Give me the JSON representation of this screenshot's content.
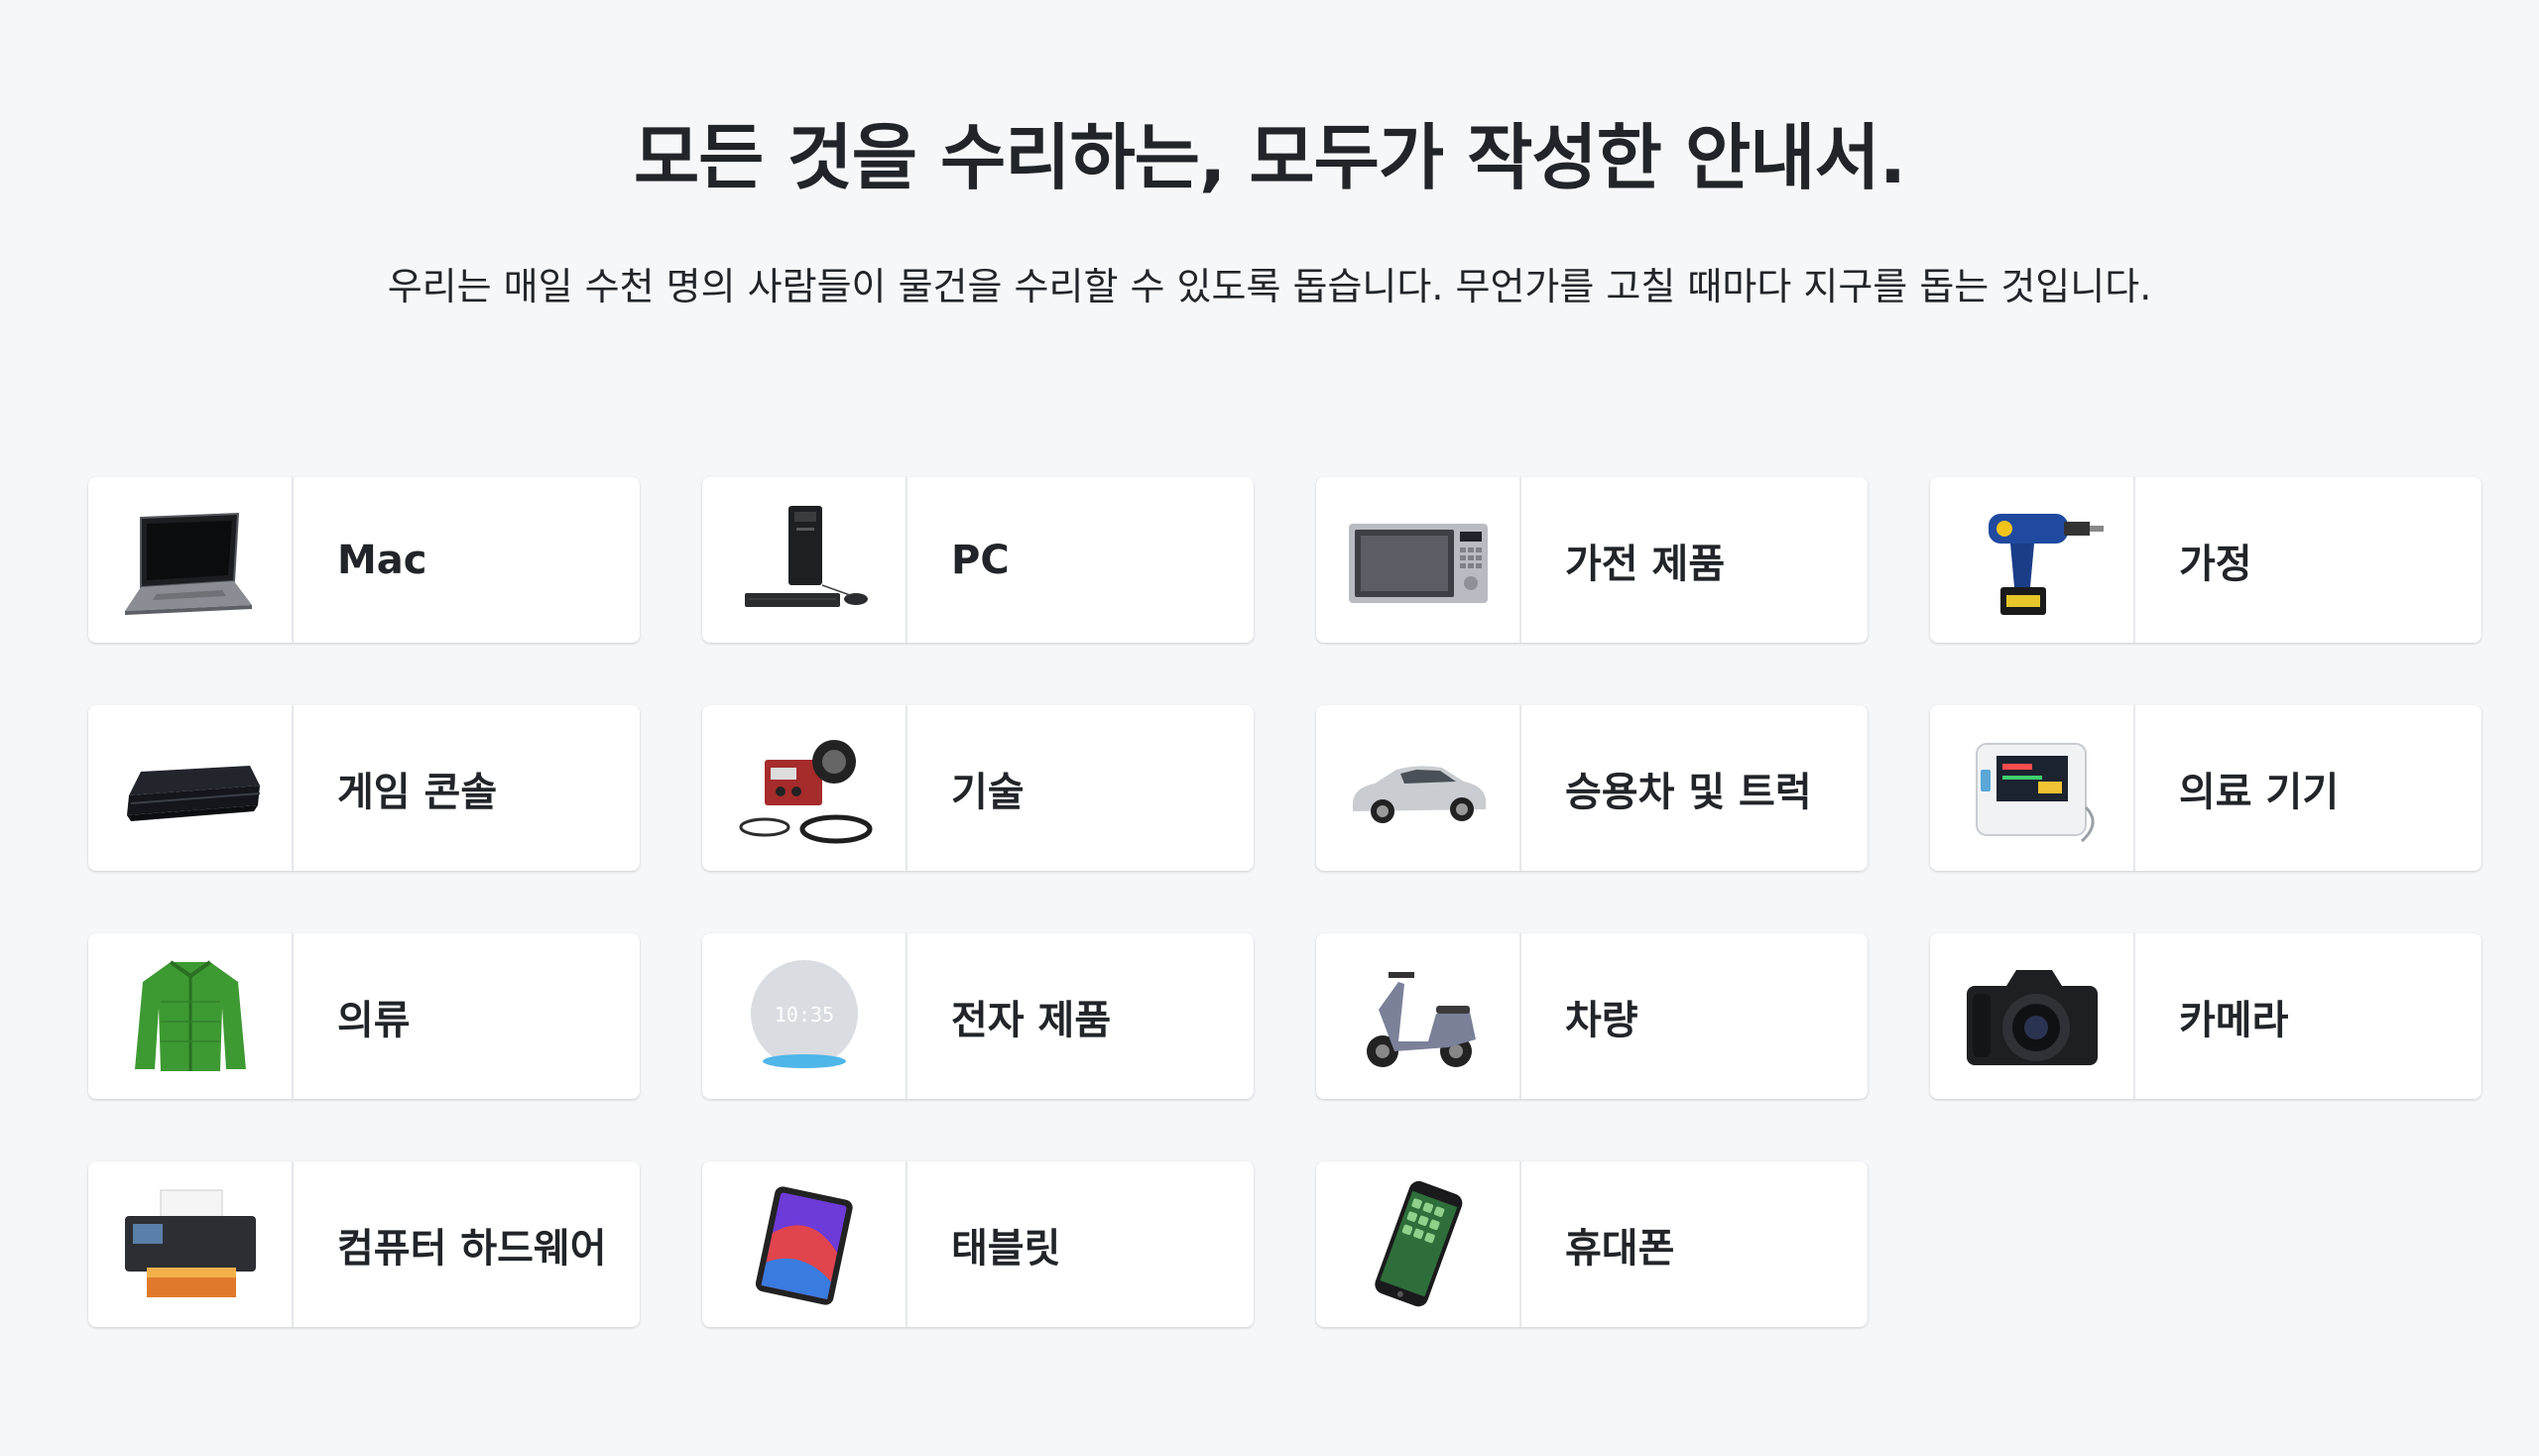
{
  "hero": {
    "title": "모든 것을 수리하는, 모두가 작성한 안내서.",
    "subtitle": "우리는 매일 수천 명의 사람들이 물건을 수리할 수 있도록 돕습니다. 무언가를 고칠 때마다 지구를 돕는 것입니다."
  },
  "categories": [
    {
      "label": "Mac",
      "icon": "laptop-icon"
    },
    {
      "label": "PC",
      "icon": "desktop-pc-icon"
    },
    {
      "label": "가전 제품",
      "icon": "microwave-icon"
    },
    {
      "label": "가정",
      "icon": "drill-icon"
    },
    {
      "label": "게임 콘솔",
      "icon": "game-console-icon"
    },
    {
      "label": "기술",
      "icon": "welder-icon"
    },
    {
      "label": "승용차 및 트럭",
      "icon": "car-icon"
    },
    {
      "label": "의료 기기",
      "icon": "medical-monitor-icon"
    },
    {
      "label": "의류",
      "icon": "jacket-icon"
    },
    {
      "label": "전자 제품",
      "icon": "smart-speaker-icon"
    },
    {
      "label": "차량",
      "icon": "scooter-icon"
    },
    {
      "label": "카메라",
      "icon": "camera-icon"
    },
    {
      "label": "컴퓨터 하드웨어",
      "icon": "printer-icon"
    },
    {
      "label": "태블릿",
      "icon": "tablet-icon"
    },
    {
      "label": "휴대폰",
      "icon": "smartphone-icon"
    }
  ],
  "speaker_clock": "10:35"
}
